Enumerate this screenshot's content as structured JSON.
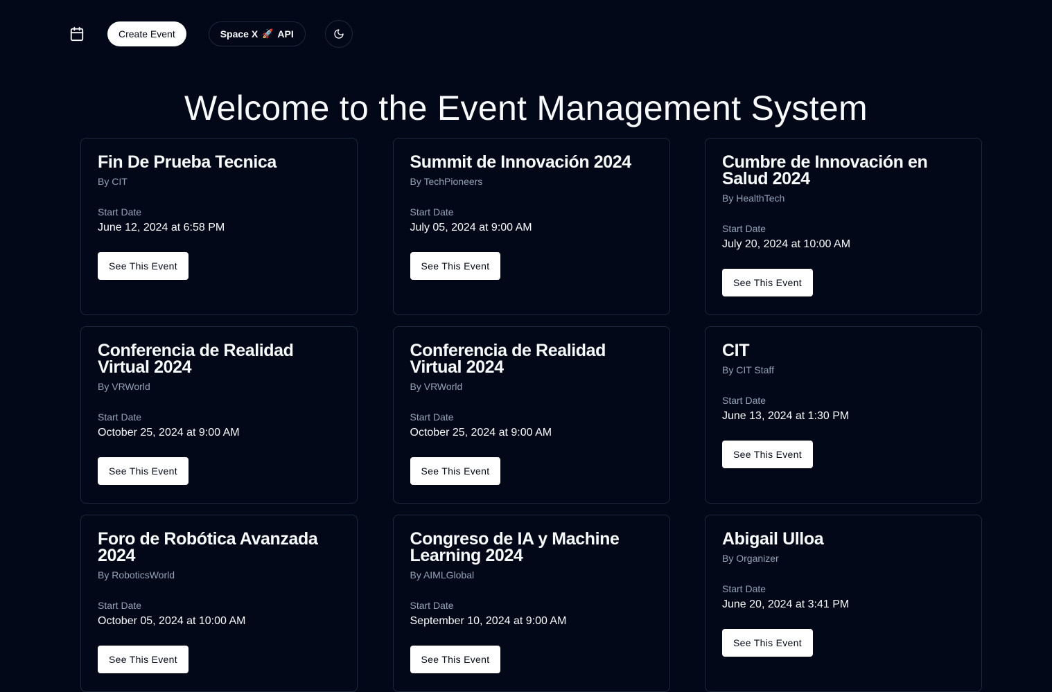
{
  "nav": {
    "calendar_icon": "calendar-icon",
    "create_label": "Create Event",
    "api_prefix": "Space X",
    "api_emoji": "🚀",
    "api_suffix": "API",
    "theme_icon": "moon-icon"
  },
  "page": {
    "title": "Welcome to the Event Management System"
  },
  "labels": {
    "start_date": "Start Date",
    "see_event": "See This Event"
  },
  "events": [
    {
      "title": "Fin De Prueba Tecnica",
      "by": "By CIT",
      "start": "June 12, 2024 at 6:58 PM"
    },
    {
      "title": "Summit de Innovación 2024",
      "by": "By TechPioneers",
      "start": "July 05, 2024 at 9:00 AM"
    },
    {
      "title": "Cumbre de Innovación en Salud 2024",
      "by": "By HealthTech",
      "start": "July 20, 2024 at 10:00 AM"
    },
    {
      "title": "Conferencia de Realidad Virtual 2024",
      "by": "By VRWorld",
      "start": "October 25, 2024 at 9:00 AM"
    },
    {
      "title": "Conferencia de Realidad Virtual 2024",
      "by": "By VRWorld",
      "start": "October 25, 2024 at 9:00 AM"
    },
    {
      "title": "CIT",
      "by": "By CIT Staff",
      "start": "June 13, 2024 at 1:30 PM"
    },
    {
      "title": "Foro de Robótica Avanzada 2024",
      "by": "By RoboticsWorld",
      "start": "October 05, 2024 at 10:00 AM"
    },
    {
      "title": "Congreso de IA y Machine Learning 2024",
      "by": "By AIMLGlobal",
      "start": "September 10, 2024 at 9:00 AM"
    },
    {
      "title": "Abigail Ulloa",
      "by": "By Organizer",
      "start": "June 20, 2024 at 3:41 PM"
    }
  ],
  "colors": {
    "background": "#020817",
    "border": "#1e293b",
    "muted_text": "#94a3b8",
    "text": "#f8fafc"
  }
}
